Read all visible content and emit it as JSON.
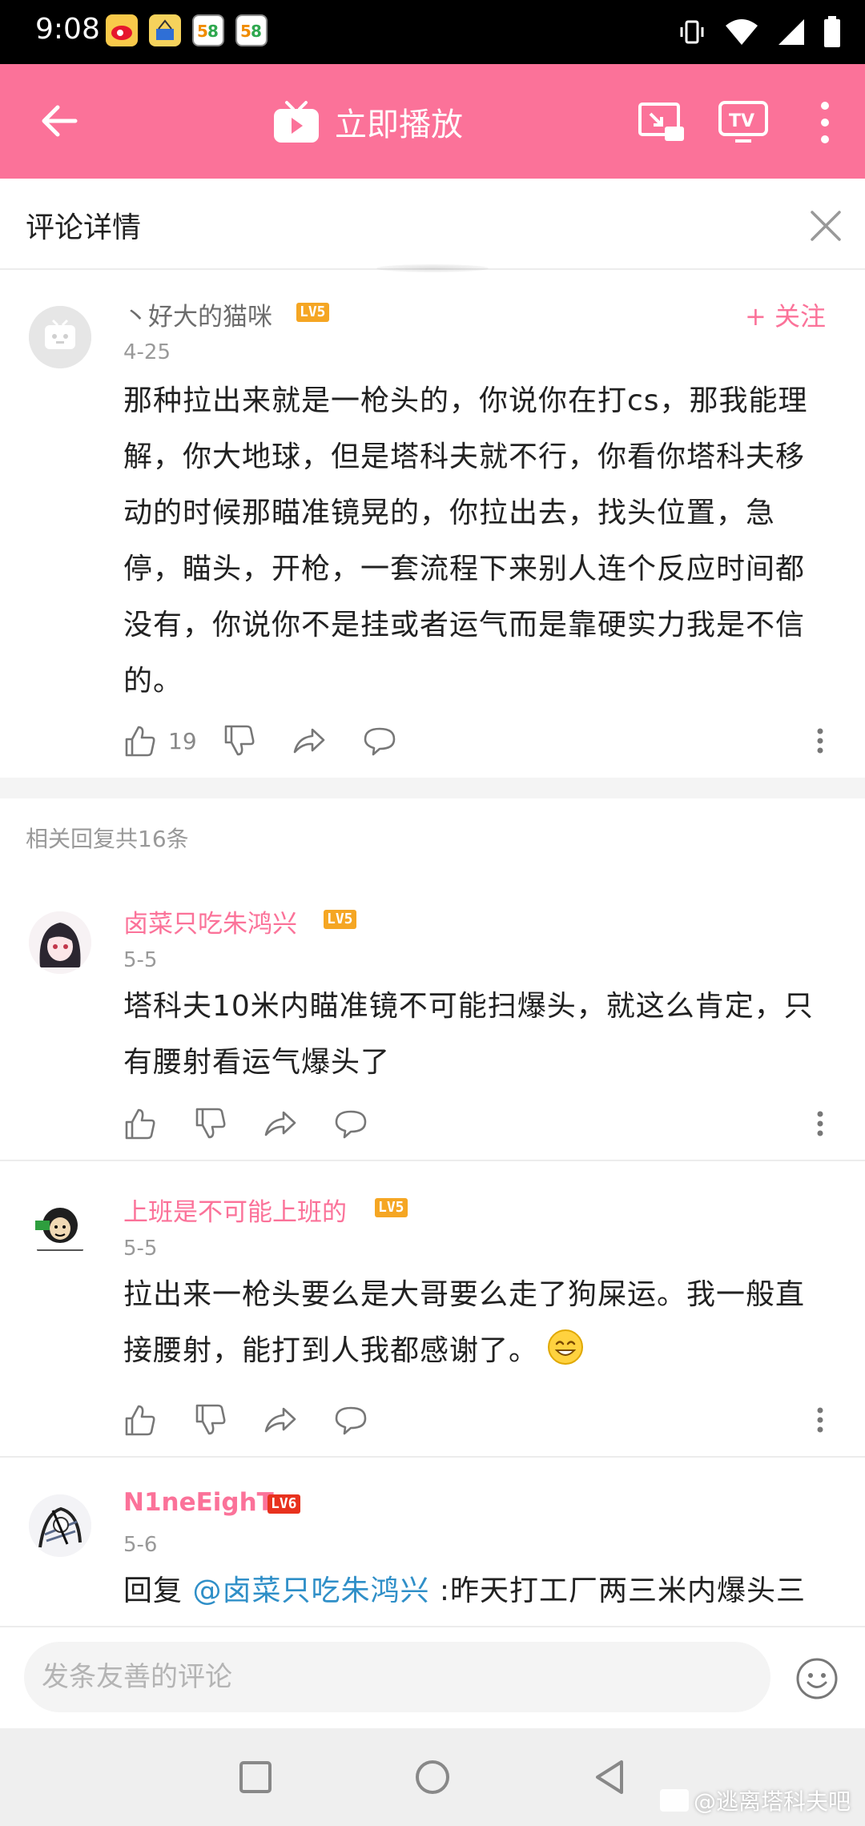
{
  "status_bar": {
    "time": "9:08",
    "notifications": [
      "weibo-icon",
      "store-icon",
      "58-icon",
      "58-icon"
    ]
  },
  "app_bar": {
    "play_now": "立即播放"
  },
  "detail": {
    "title": "评论详情"
  },
  "main_comment": {
    "username": "丶好大的猫咪",
    "level": "LV5",
    "date": "4-25",
    "follow": "+ 关注",
    "text": "那种拉出来就是一枪头的，你说你在打cs，那我能理解，你大地球，但是塔科夫就不行，你看你塔科夫移动的时候那瞄准镜晃的，你拉出去，找头位置，急停，瞄头，开枪，一套流程下来别人连个反应时间都没有，你说你不是挂或者运气而是靠硬实力我是不信的。",
    "likes": "19"
  },
  "replies_header": "相关回复共16条",
  "replies": [
    {
      "username": "卤菜只吃朱鸿兴",
      "level": "LV5",
      "date": "5-5",
      "text": "塔科夫10米内瞄准镜不可能扫爆头，就这么肯定，只有腰射看运气爆头了"
    },
    {
      "username": "上班是不可能上班的",
      "level": "LV5",
      "date": "5-5",
      "text": "拉出来一枪头要么是大哥要么走了狗屎运。我一般直接腰射，能打到人我都感谢了。"
    },
    {
      "username": "N1neEighT",
      "level": "LV6",
      "date": "5-6",
      "reply_prefix": "回复 ",
      "mention": "@卤菜只吃朱鸿兴",
      "text": " :昨天打工厂两三米内爆头三"
    }
  ],
  "input": {
    "placeholder": "发条友善的评论"
  },
  "watermark": "@逃离塔科夫吧",
  "colors": {
    "accent": "#fb7299",
    "lv5": "#f5a623",
    "lv6": "#e8321e",
    "mention": "#2f8fc8"
  }
}
